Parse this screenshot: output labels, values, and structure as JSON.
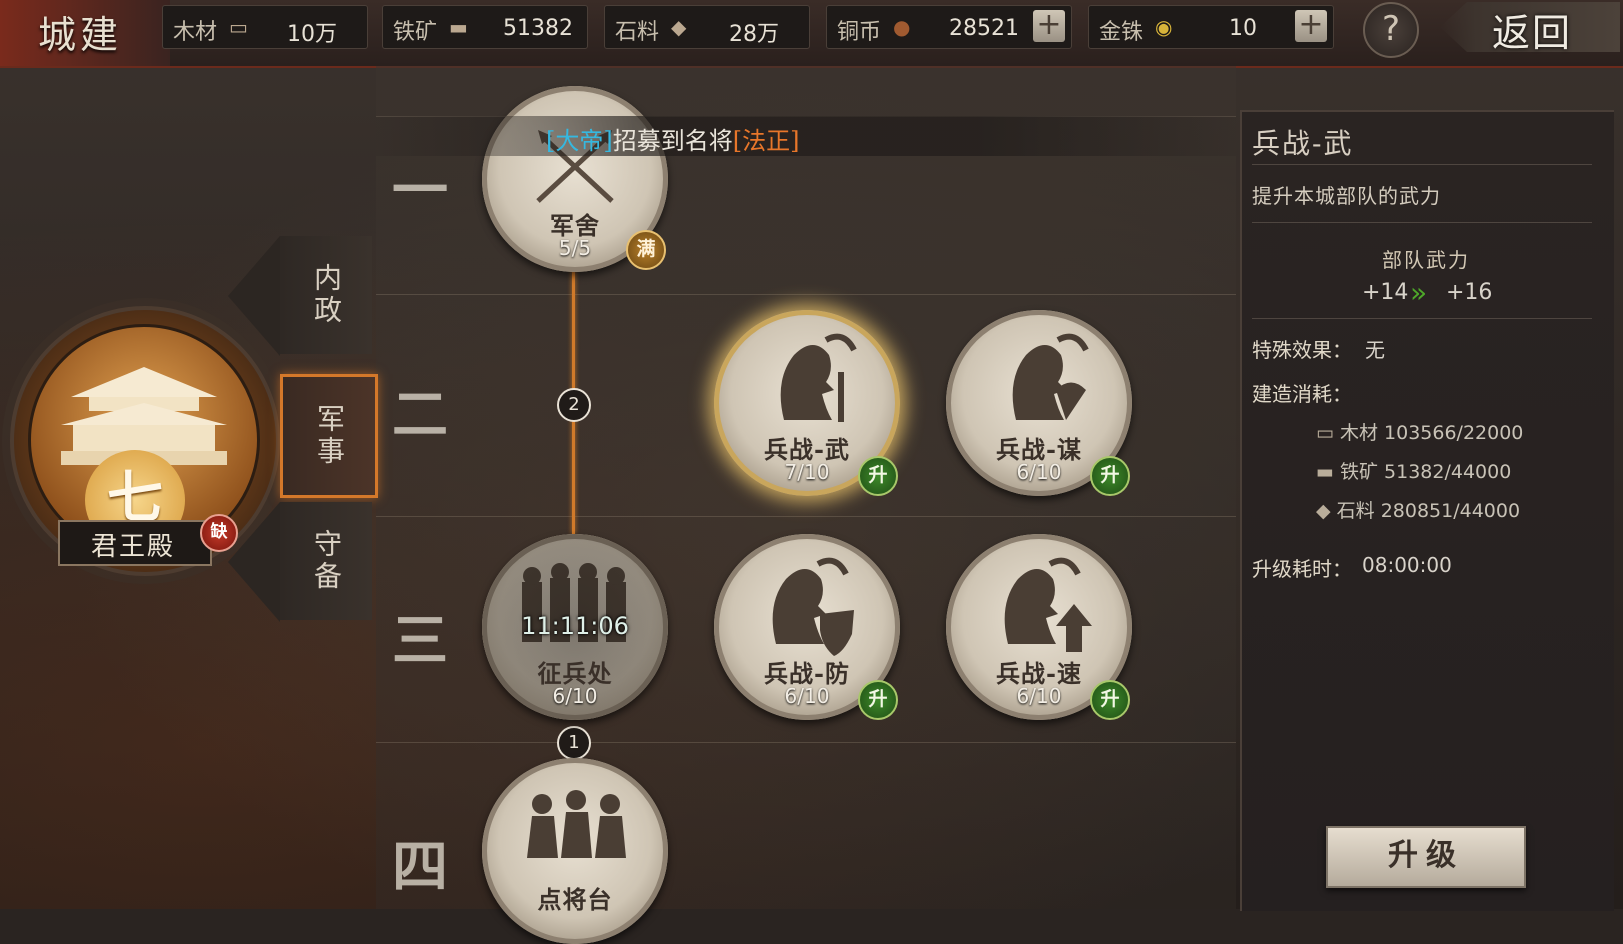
{
  "header": {
    "title": "城建",
    "resources": [
      {
        "label": "木材",
        "icon": "wood-icon",
        "value": "10万"
      },
      {
        "label": "铁矿",
        "icon": "anvil-icon",
        "value": "51382"
      },
      {
        "label": "石料",
        "icon": "stone-icon",
        "value": "28万"
      },
      {
        "label": "铜币",
        "icon": "copper-coin-icon",
        "value": "28521"
      },
      {
        "label": "金铢",
        "icon": "gold-coin-icon",
        "value": "10"
      }
    ],
    "plus": "+",
    "help": "?",
    "back": "返回"
  },
  "notice": {
    "part1": "[大帝]",
    "part2": "招募到名将",
    "part3": "[法正]"
  },
  "tiers": [
    "一",
    "二",
    "三",
    "四"
  ],
  "connectors": [
    "2",
    "1"
  ],
  "nodes": [
    {
      "name": "军舍",
      "level": "5/5",
      "badge": "满"
    },
    {
      "name": "兵战-武",
      "level": "7/10",
      "badge": "升"
    },
    {
      "name": "兵战-谋",
      "level": "6/10",
      "badge": "升"
    },
    {
      "name": "征兵处",
      "level": "6/10",
      "timer": "11:11:06"
    },
    {
      "name": "兵战-防",
      "level": "6/10",
      "badge": "升"
    },
    {
      "name": "兵战-速",
      "level": "6/10",
      "badge": "升"
    },
    {
      "name": "点将台",
      "level": ""
    }
  ],
  "palace": {
    "level_char": "七",
    "name": "君王殿",
    "lack_badge": "缺"
  },
  "tabs": [
    "内政",
    "军事",
    "守备"
  ],
  "detail": {
    "title": "兵战-武",
    "description": "提升本城部队的武力",
    "attribute": "部队武力",
    "from": "+14",
    "to": "+16",
    "effect_label": "特殊效果：",
    "effect_value": "无",
    "cost_title": "建造消耗：",
    "costs": [
      {
        "label": "木材",
        "value": "103566/22000"
      },
      {
        "label": "铁矿",
        "value": "51382/44000"
      },
      {
        "label": "石料",
        "value": "280851/44000"
      }
    ],
    "time_label": "升级耗时：",
    "time_value": "08:00:00",
    "upgrade": "升级"
  },
  "colors": {
    "accent_orange": "#d07a2a",
    "upgrade_green": "#3e8a2a",
    "notice_blue": "#35b8e0"
  }
}
